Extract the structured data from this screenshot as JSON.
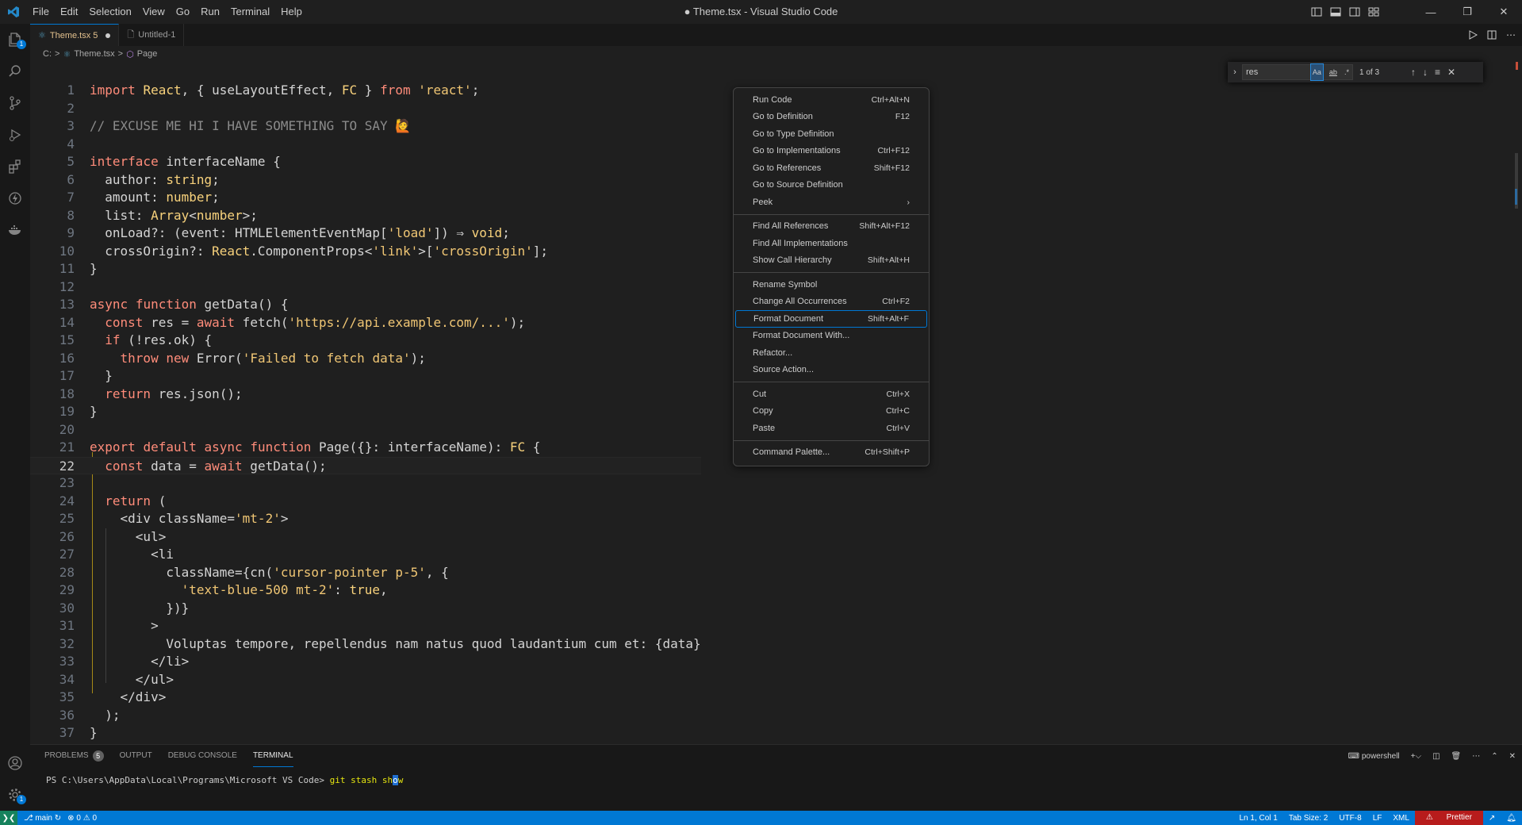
{
  "titlebar": {
    "menu": [
      "File",
      "Edit",
      "Selection",
      "View",
      "Go",
      "Run",
      "Terminal",
      "Help"
    ],
    "title": "● Theme.tsx - Visual Studio Code"
  },
  "activity": {
    "explorer_badge": "1",
    "settings_badge": "1"
  },
  "tabs": [
    {
      "label": "Theme.tsx 5"
    },
    {
      "label": "Untitled-1"
    }
  ],
  "breadcrumb": {
    "drive": "C:",
    "sep1": ">",
    "file": "Theme.tsx",
    "sep2": ">",
    "symbol": "Page"
  },
  "code": {
    "current_line": 22,
    "lines": [
      {
        "n": "1",
        "t": "import React, { useLayoutEffect, FC } from 'react';"
      },
      {
        "n": "2",
        "t": ""
      },
      {
        "n": "3",
        "t": "// EXCUSE ME HI I HAVE SOMETHING TO SAY 🙋"
      },
      {
        "n": "4",
        "t": ""
      },
      {
        "n": "5",
        "t": "interface interfaceName {"
      },
      {
        "n": "6",
        "t": "  author: string;"
      },
      {
        "n": "7",
        "t": "  amount: number;"
      },
      {
        "n": "8",
        "t": "  list: Array<number>;"
      },
      {
        "n": "9",
        "t": "  onLoad?: (event: HTMLElementEventMap['load']) ⇒ void;"
      },
      {
        "n": "10",
        "t": "  crossOrigin?: React.ComponentProps<'link'>['crossOrigin'];"
      },
      {
        "n": "11",
        "t": "}"
      },
      {
        "n": "12",
        "t": ""
      },
      {
        "n": "13",
        "t": "async function getData() {"
      },
      {
        "n": "14",
        "t": "  const res = await fetch('https://api.example.com/...');"
      },
      {
        "n": "15",
        "t": "  if (!res.ok) {"
      },
      {
        "n": "16",
        "t": "    throw new Error('Failed to fetch data');"
      },
      {
        "n": "17",
        "t": "  }"
      },
      {
        "n": "18",
        "t": "  return res.json();"
      },
      {
        "n": "19",
        "t": "}"
      },
      {
        "n": "20",
        "t": ""
      },
      {
        "n": "21",
        "t": "export default async function Page({}: interfaceName): FC {"
      },
      {
        "n": "22",
        "t": "  const data = await getData();"
      },
      {
        "n": "23",
        "t": ""
      },
      {
        "n": "24",
        "t": "  return ("
      },
      {
        "n": "25",
        "t": "    <div className='mt-2'>"
      },
      {
        "n": "26",
        "t": "      <ul>"
      },
      {
        "n": "27",
        "t": "        <li"
      },
      {
        "n": "28",
        "t": "          className={cn('cursor-pointer p-5', {"
      },
      {
        "n": "29",
        "t": "            'text-blue-500 mt-2': true,"
      },
      {
        "n": "30",
        "t": "          })}"
      },
      {
        "n": "31",
        "t": "        >"
      },
      {
        "n": "32",
        "t": "          Voluptas tempore, repellendus nam natus quod laudantium cum et: {data}"
      },
      {
        "n": "33",
        "t": "        </li>"
      },
      {
        "n": "34",
        "t": "      </ul>"
      },
      {
        "n": "35",
        "t": "    </div>"
      },
      {
        "n": "36",
        "t": "  );"
      },
      {
        "n": "37",
        "t": "}"
      }
    ]
  },
  "find": {
    "query": "res",
    "opt_case": "Aa",
    "opt_word": "ab",
    "opt_regex": ".*",
    "count": "1 of 3"
  },
  "context_menu": {
    "items": [
      {
        "label": "Run Code",
        "key": "Ctrl+Alt+N"
      },
      {
        "label": "Go to Definition",
        "key": "F12"
      },
      {
        "label": "Go to Type Definition",
        "key": ""
      },
      {
        "label": "Go to Implementations",
        "key": "Ctrl+F12"
      },
      {
        "label": "Go to References",
        "key": "Shift+F12"
      },
      {
        "label": "Go to Source Definition",
        "key": ""
      },
      {
        "label": "Peek",
        "key": "›"
      },
      {
        "sep": true
      },
      {
        "label": "Find All References",
        "key": "Shift+Alt+F12"
      },
      {
        "label": "Find All Implementations",
        "key": ""
      },
      {
        "label": "Show Call Hierarchy",
        "key": "Shift+Alt+H"
      },
      {
        "sep": true
      },
      {
        "label": "Rename Symbol",
        "key": ""
      },
      {
        "label": "Change All Occurrences",
        "key": "Ctrl+F2"
      },
      {
        "label": "Format Document",
        "key": "Shift+Alt+F",
        "selected": true
      },
      {
        "label": "Format Document With...",
        "key": ""
      },
      {
        "label": "Refactor...",
        "key": ""
      },
      {
        "label": "Source Action...",
        "key": ""
      },
      {
        "sep": true
      },
      {
        "label": "Cut",
        "key": "Ctrl+X"
      },
      {
        "label": "Copy",
        "key": "Ctrl+C"
      },
      {
        "label": "Paste",
        "key": "Ctrl+V"
      },
      {
        "sep": true
      },
      {
        "label": "Command Palette...",
        "key": "Ctrl+Shift+P"
      }
    ]
  },
  "panel": {
    "tabs": [
      {
        "label": "PROBLEMS",
        "badge": "5"
      },
      {
        "label": "OUTPUT"
      },
      {
        "label": "DEBUG CONSOLE"
      },
      {
        "label": "TERMINAL"
      }
    ],
    "shell": "powershell",
    "terminal_prompt": "PS C:\\Users\\AppData\\Local\\Programs\\Microsoft VS Code> ",
    "terminal_cmd": "git stash sh",
    "terminal_cursor": "o",
    "terminal_rest": "w"
  },
  "status": {
    "branch": "main",
    "errors": "0",
    "warnings": "0",
    "position": "Ln 1, Col 1",
    "tab_size": "Tab Size: 2",
    "encoding": "UTF-8",
    "eol": "LF",
    "language": "XML",
    "prettier": "Prettier"
  },
  "colors": {
    "accent": "#0078d4",
    "statusbar": "#0078d4",
    "remote": "#16825d",
    "prettier_bg": "#b71c1c"
  }
}
